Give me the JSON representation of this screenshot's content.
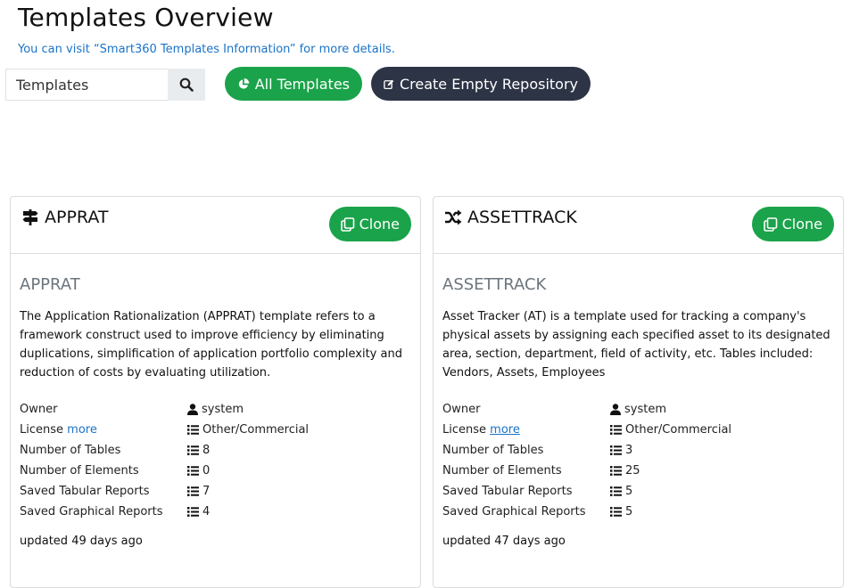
{
  "header": {
    "title": "Templates Overview",
    "info": "You can visit “Smart360 Templates Information” for more details."
  },
  "toolbar": {
    "search_value": "Templates",
    "all_templates_label": "All Templates",
    "create_repo_label": "Create Empty Repository"
  },
  "colors": {
    "green": "#1aa34a",
    "dark": "#2d3446",
    "link": "#1a73c8"
  },
  "cards": [
    {
      "name": "APPRAT",
      "icon": "signpost-icon",
      "clone_label": "Clone",
      "subtitle": "APPRAT",
      "description": "The Application Rationalization (APPRAT) template refers to a framework construct used to improve efficiency by eliminating duplications, simplification of application portfolio complexity and reduction of costs by evaluating utilization.",
      "owner_label": "Owner",
      "owner": "system",
      "license_label": "License",
      "license_more": "more",
      "license": "Other/Commercial",
      "tables_label": "Number of Tables",
      "tables": "8",
      "elements_label": "Number of Elements",
      "elements": "0",
      "tabular_label": "Saved Tabular Reports",
      "tabular": "7",
      "graphical_label": "Saved Graphical Reports",
      "graphical": "4",
      "updated": "updated 49 days ago"
    },
    {
      "name": "ASSETTRACK",
      "icon": "shuffle-icon",
      "clone_label": "Clone",
      "subtitle": "ASSETTRACK",
      "description": "Asset Tracker (AT) is a template used for tracking a company's physical assets by assigning each specified asset to its designated area, section, department, field of activity, etc. Tables included: Vendors, Assets, Employees",
      "owner_label": "Owner",
      "owner": "system",
      "license_label": "License",
      "license_more": "more",
      "license": "Other/Commercial",
      "tables_label": "Number of Tables",
      "tables": "3",
      "elements_label": "Number of Elements",
      "elements": "25",
      "tabular_label": "Saved Tabular Reports",
      "tabular": "5",
      "graphical_label": "Saved Graphical Reports",
      "graphical": "5",
      "updated": "updated 47 days ago"
    }
  ]
}
